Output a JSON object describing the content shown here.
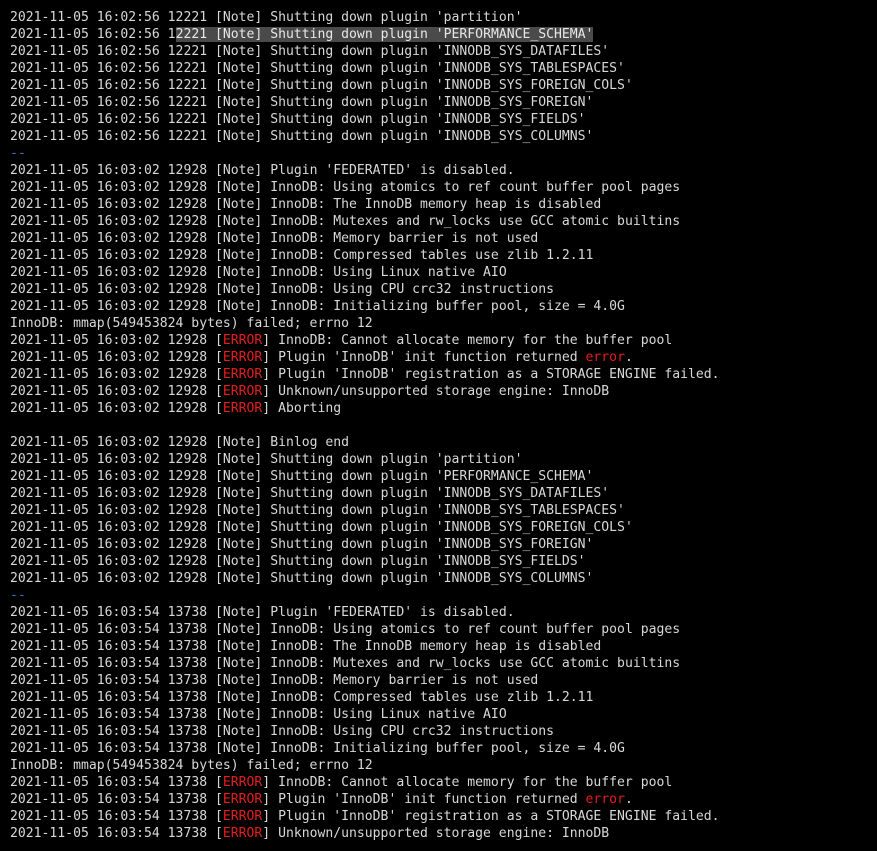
{
  "terminal": {
    "colors": {
      "background": "#000000",
      "text": "#d8d8d8",
      "error": "#e81d1d",
      "separator": "#3a73c7",
      "selection": "#4a4a4a"
    },
    "lines": [
      {
        "ts": "2021-11-05 16:02:56",
        "pid": "12221",
        "level": "Note",
        "msg": "Shutting down plugin 'partition'"
      },
      {
        "ts": "2021-11-05 16:02:56",
        "pid": "12221",
        "level": "Note",
        "msg": "Shutting down plugin 'PERFORMANCE_SCHEMA'",
        "selected": true
      },
      {
        "ts": "2021-11-05 16:02:56",
        "pid": "12221",
        "level": "Note",
        "msg": "Shutting down plugin 'INNODB_SYS_DATAFILES'"
      },
      {
        "ts": "2021-11-05 16:02:56",
        "pid": "12221",
        "level": "Note",
        "msg": "Shutting down plugin 'INNODB_SYS_TABLESPACES'"
      },
      {
        "ts": "2021-11-05 16:02:56",
        "pid": "12221",
        "level": "Note",
        "msg": "Shutting down plugin 'INNODB_SYS_FOREIGN_COLS'"
      },
      {
        "ts": "2021-11-05 16:02:56",
        "pid": "12221",
        "level": "Note",
        "msg": "Shutting down plugin 'INNODB_SYS_FOREIGN'"
      },
      {
        "ts": "2021-11-05 16:02:56",
        "pid": "12221",
        "level": "Note",
        "msg": "Shutting down plugin 'INNODB_SYS_FIELDS'"
      },
      {
        "ts": "2021-11-05 16:02:56",
        "pid": "12221",
        "level": "Note",
        "msg": "Shutting down plugin 'INNODB_SYS_COLUMNS'"
      },
      {
        "raw": "--",
        "separator": true
      },
      {
        "ts": "2021-11-05 16:03:02",
        "pid": "12928",
        "level": "Note",
        "msg": "Plugin 'FEDERATED' is disabled."
      },
      {
        "ts": "2021-11-05 16:03:02",
        "pid": "12928",
        "level": "Note",
        "msg": "InnoDB: Using atomics to ref count buffer pool pages"
      },
      {
        "ts": "2021-11-05 16:03:02",
        "pid": "12928",
        "level": "Note",
        "msg": "InnoDB: The InnoDB memory heap is disabled"
      },
      {
        "ts": "2021-11-05 16:03:02",
        "pid": "12928",
        "level": "Note",
        "msg": "InnoDB: Mutexes and rw_locks use GCC atomic builtins"
      },
      {
        "ts": "2021-11-05 16:03:02",
        "pid": "12928",
        "level": "Note",
        "msg": "InnoDB: Memory barrier is not used"
      },
      {
        "ts": "2021-11-05 16:03:02",
        "pid": "12928",
        "level": "Note",
        "msg": "InnoDB: Compressed tables use zlib 1.2.11"
      },
      {
        "ts": "2021-11-05 16:03:02",
        "pid": "12928",
        "level": "Note",
        "msg": "InnoDB: Using Linux native AIO"
      },
      {
        "ts": "2021-11-05 16:03:02",
        "pid": "12928",
        "level": "Note",
        "msg": "InnoDB: Using CPU crc32 instructions"
      },
      {
        "ts": "2021-11-05 16:03:02",
        "pid": "12928",
        "level": "Note",
        "msg": "InnoDB: Initializing buffer pool, size = 4.0G"
      },
      {
        "raw": "InnoDB: mmap(549453824 bytes) failed; errno 12"
      },
      {
        "ts": "2021-11-05 16:03:02",
        "pid": "12928",
        "level": "ERROR",
        "msg": "InnoDB: Cannot allocate memory for the buffer pool"
      },
      {
        "ts": "2021-11-05 16:03:02",
        "pid": "12928",
        "level": "ERROR",
        "msg": "Plugin 'InnoDB' init function returned ",
        "err_word": "error",
        "msg_tail": "."
      },
      {
        "ts": "2021-11-05 16:03:02",
        "pid": "12928",
        "level": "ERROR",
        "msg": "Plugin 'InnoDB' registration as a STORAGE ENGINE failed."
      },
      {
        "ts": "2021-11-05 16:03:02",
        "pid": "12928",
        "level": "ERROR",
        "msg": "Unknown/unsupported storage engine: InnoDB"
      },
      {
        "ts": "2021-11-05 16:03:02",
        "pid": "12928",
        "level": "ERROR",
        "msg": "Aborting"
      },
      {
        "raw": ""
      },
      {
        "ts": "2021-11-05 16:03:02",
        "pid": "12928",
        "level": "Note",
        "msg": "Binlog end"
      },
      {
        "ts": "2021-11-05 16:03:02",
        "pid": "12928",
        "level": "Note",
        "msg": "Shutting down plugin 'partition'"
      },
      {
        "ts": "2021-11-05 16:03:02",
        "pid": "12928",
        "level": "Note",
        "msg": "Shutting down plugin 'PERFORMANCE_SCHEMA'"
      },
      {
        "ts": "2021-11-05 16:03:02",
        "pid": "12928",
        "level": "Note",
        "msg": "Shutting down plugin 'INNODB_SYS_DATAFILES'"
      },
      {
        "ts": "2021-11-05 16:03:02",
        "pid": "12928",
        "level": "Note",
        "msg": "Shutting down plugin 'INNODB_SYS_TABLESPACES'"
      },
      {
        "ts": "2021-11-05 16:03:02",
        "pid": "12928",
        "level": "Note",
        "msg": "Shutting down plugin 'INNODB_SYS_FOREIGN_COLS'"
      },
      {
        "ts": "2021-11-05 16:03:02",
        "pid": "12928",
        "level": "Note",
        "msg": "Shutting down plugin 'INNODB_SYS_FOREIGN'"
      },
      {
        "ts": "2021-11-05 16:03:02",
        "pid": "12928",
        "level": "Note",
        "msg": "Shutting down plugin 'INNODB_SYS_FIELDS'"
      },
      {
        "ts": "2021-11-05 16:03:02",
        "pid": "12928",
        "level": "Note",
        "msg": "Shutting down plugin 'INNODB_SYS_COLUMNS'"
      },
      {
        "raw": "--",
        "separator": true
      },
      {
        "ts": "2021-11-05 16:03:54",
        "pid": "13738",
        "level": "Note",
        "msg": "Plugin 'FEDERATED' is disabled."
      },
      {
        "ts": "2021-11-05 16:03:54",
        "pid": "13738",
        "level": "Note",
        "msg": "InnoDB: Using atomics to ref count buffer pool pages"
      },
      {
        "ts": "2021-11-05 16:03:54",
        "pid": "13738",
        "level": "Note",
        "msg": "InnoDB: The InnoDB memory heap is disabled"
      },
      {
        "ts": "2021-11-05 16:03:54",
        "pid": "13738",
        "level": "Note",
        "msg": "InnoDB: Mutexes and rw_locks use GCC atomic builtins"
      },
      {
        "ts": "2021-11-05 16:03:54",
        "pid": "13738",
        "level": "Note",
        "msg": "InnoDB: Memory barrier is not used"
      },
      {
        "ts": "2021-11-05 16:03:54",
        "pid": "13738",
        "level": "Note",
        "msg": "InnoDB: Compressed tables use zlib 1.2.11"
      },
      {
        "ts": "2021-11-05 16:03:54",
        "pid": "13738",
        "level": "Note",
        "msg": "InnoDB: Using Linux native AIO"
      },
      {
        "ts": "2021-11-05 16:03:54",
        "pid": "13738",
        "level": "Note",
        "msg": "InnoDB: Using CPU crc32 instructions"
      },
      {
        "ts": "2021-11-05 16:03:54",
        "pid": "13738",
        "level": "Note",
        "msg": "InnoDB: Initializing buffer pool, size = 4.0G"
      },
      {
        "raw": "InnoDB: mmap(549453824 bytes) failed; errno 12"
      },
      {
        "ts": "2021-11-05 16:03:54",
        "pid": "13738",
        "level": "ERROR",
        "msg": "InnoDB: Cannot allocate memory for the buffer pool"
      },
      {
        "ts": "2021-11-05 16:03:54",
        "pid": "13738",
        "level": "ERROR",
        "msg": "Plugin 'InnoDB' init function returned ",
        "err_word": "error",
        "msg_tail": "."
      },
      {
        "ts": "2021-11-05 16:03:54",
        "pid": "13738",
        "level": "ERROR",
        "msg": "Plugin 'InnoDB' registration as a STORAGE ENGINE failed."
      },
      {
        "ts": "2021-11-05 16:03:54",
        "pid": "13738",
        "level": "ERROR",
        "msg": "Unknown/unsupported storage engine: InnoDB"
      }
    ]
  }
}
